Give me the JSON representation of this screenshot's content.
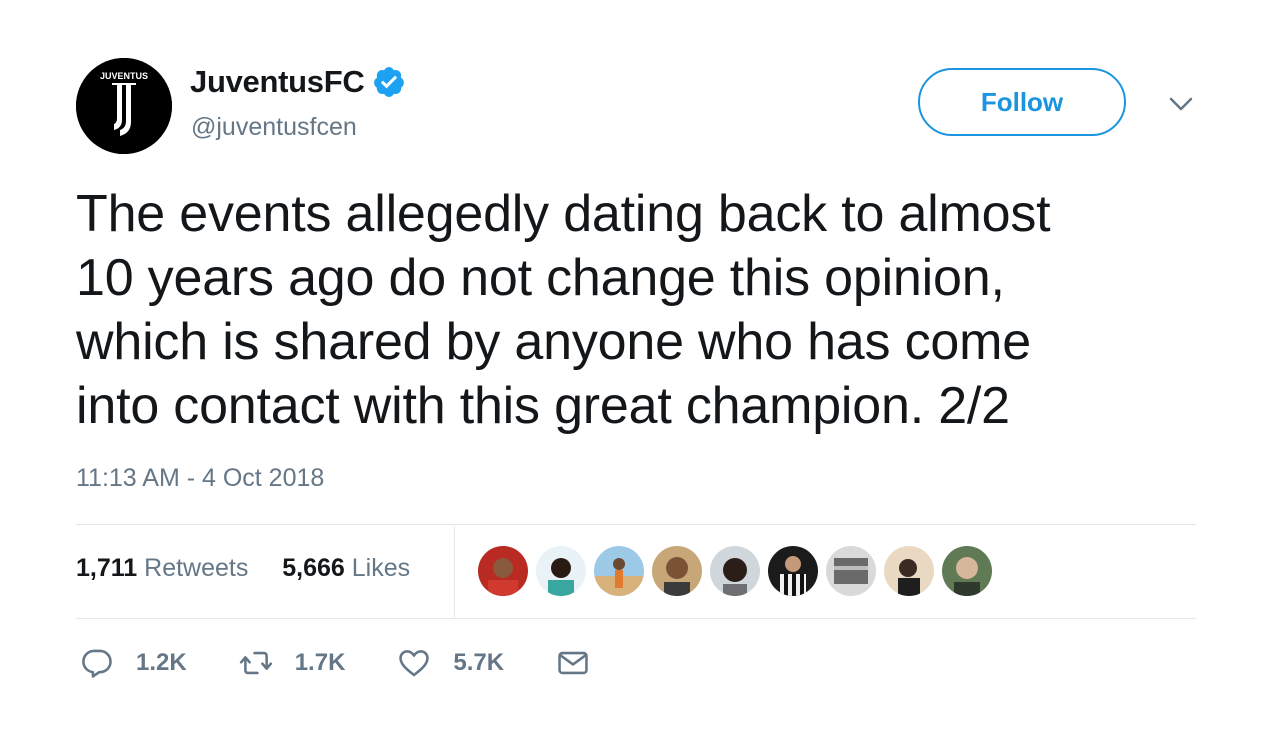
{
  "user": {
    "display_name": "JuventusFC",
    "handle": "@juventusfcen",
    "avatar_text": "JUVENTUS",
    "verified": true
  },
  "follow_label": "Follow",
  "tweet": {
    "lines": [
      "The events allegedly dating back to almost",
      "10 years ago do not change this opinion,",
      "which is shared by anyone who has come",
      "into contact with this great champion. 2/2"
    ],
    "timestamp": "11:13 AM - 4 Oct 2018"
  },
  "stats": {
    "retweets_count": "1,711",
    "retweets_label": "Retweets",
    "likes_count": "5,666",
    "likes_label": "Likes"
  },
  "actions": {
    "reply_count": "1.2K",
    "retweet_count": "1.7K",
    "like_count": "5.7K"
  },
  "colors": {
    "accent": "#1b95e0",
    "muted": "#657786",
    "text": "#14171a",
    "verified": "#1da1f2"
  }
}
